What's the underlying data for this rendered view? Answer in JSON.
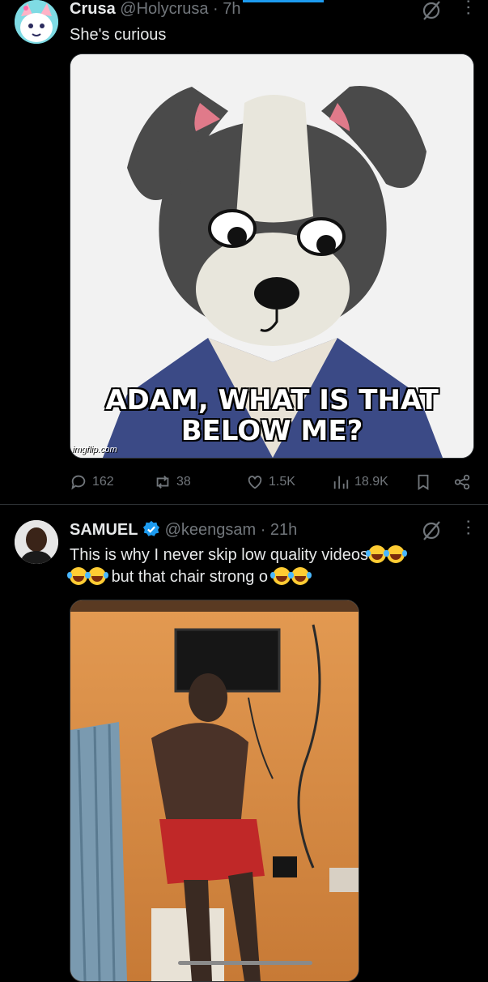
{
  "tweets": [
    {
      "display_name": "Crusa",
      "handle": "@Holycrusa",
      "time": "· 7h",
      "text": "She's curious",
      "media": {
        "caption": "ADAM, WHAT IS THAT BELOW ME?",
        "watermark": "imgflip.com"
      },
      "stats": {
        "replies": "162",
        "reposts": "38",
        "likes": "1.5K",
        "views": "18.9K"
      }
    },
    {
      "display_name": "SAMUEL",
      "handle": "@keengsam",
      "time": "· 21h",
      "text_line1": "This is why I never skip low quality videos",
      "text_line2": "but that chair strong o"
    }
  ],
  "icons": {
    "reply": "speech-bubble-icon",
    "repost": "repost-arrows-icon",
    "like": "heart-icon",
    "views": "bar-chart-icon",
    "bookmark": "bookmark-icon",
    "share": "share-icon",
    "grok": "grok-icon",
    "more": "more-dots-icon",
    "verified": "verified-badge-icon",
    "emoji": "tears-of-joy-emoji"
  },
  "colors": {
    "accent": "#1d9bf0",
    "muted": "#71767b",
    "text": "#e7e9ea",
    "background": "#000000"
  }
}
